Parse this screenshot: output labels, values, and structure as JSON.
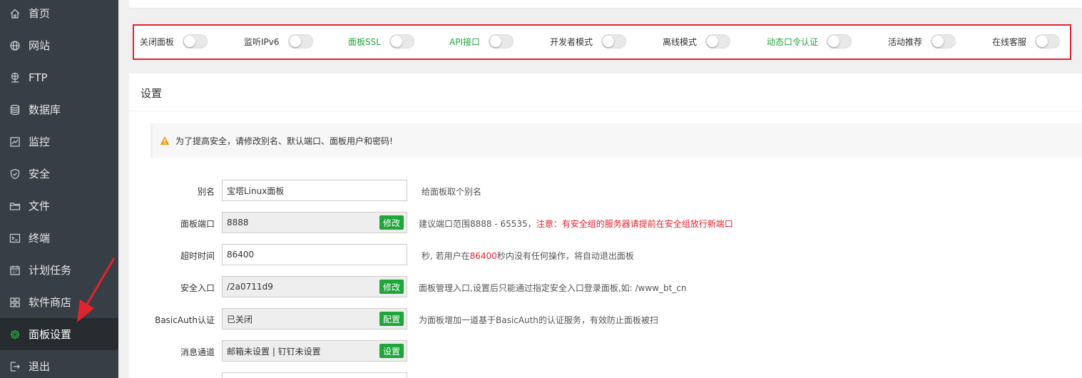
{
  "sidebar": {
    "items": [
      {
        "label": "首页",
        "icon": "home-icon"
      },
      {
        "label": "网站",
        "icon": "globe-icon"
      },
      {
        "label": "FTP",
        "icon": "ftp-icon"
      },
      {
        "label": "数据库",
        "icon": "database-icon"
      },
      {
        "label": "监控",
        "icon": "monitor-icon"
      },
      {
        "label": "安全",
        "icon": "shield-icon"
      },
      {
        "label": "文件",
        "icon": "folder-icon"
      },
      {
        "label": "终端",
        "icon": "terminal-icon"
      },
      {
        "label": "计划任务",
        "icon": "calendar-icon"
      },
      {
        "label": "软件商店",
        "icon": "grid-icon"
      },
      {
        "label": "面板设置",
        "icon": "gear-icon",
        "active": true
      },
      {
        "label": "退出",
        "icon": "logout-icon"
      }
    ]
  },
  "toggles": [
    {
      "label": "关闭面板",
      "on": false
    },
    {
      "label": "监听IPv6",
      "on": false
    },
    {
      "label": "面板SSL",
      "on": false,
      "green": true
    },
    {
      "label": "API接口",
      "on": false,
      "green": true
    },
    {
      "label": "开发者模式",
      "on": false
    },
    {
      "label": "离线模式",
      "on": false
    },
    {
      "label": "动态口令认证",
      "on": false,
      "green": true
    },
    {
      "label": "活动推荐",
      "on": false
    },
    {
      "label": "在线客服",
      "on": false
    }
  ],
  "settings": {
    "title": "设置",
    "alert": "为了提高安全，请修改别名、默认端口、面板用户和密码!",
    "rows": {
      "alias": {
        "label": "别名",
        "value": "宝塔Linux面板",
        "hint": "给面板取个别名"
      },
      "port": {
        "label": "面板端口",
        "value": "8888",
        "button": "修改",
        "hint": "建议端口范围8888 - 65535，",
        "hint_red": "注意：有安全组的服务器请提前在安全组放行新端口"
      },
      "timeout": {
        "label": "超时时间",
        "value": "86400",
        "hint_pre": "秒, 若用户在",
        "hint_red": "86400",
        "hint_post": "秒内没有任何操作，将自动退出面板"
      },
      "entry": {
        "label": "安全入口",
        "value": "/2a0711d9",
        "button": "修改",
        "hint": "面板管理入口,设置后只能通过指定安全入口登录面板,如: /www_bt_cn"
      },
      "basicauth": {
        "label": "BasicAuth认证",
        "value": "已关闭",
        "button": "配置",
        "hint": "为面板增加一道基于BasicAuth的认证服务，有效防止面板被扫"
      },
      "notify": {
        "label": "消息通道",
        "value": "邮箱未设置 | 钉钉未设置",
        "button": "设置"
      }
    }
  },
  "colors": {
    "accent": "#20a53a",
    "highlight": "#e0242e",
    "sidebar": "#383e45"
  }
}
